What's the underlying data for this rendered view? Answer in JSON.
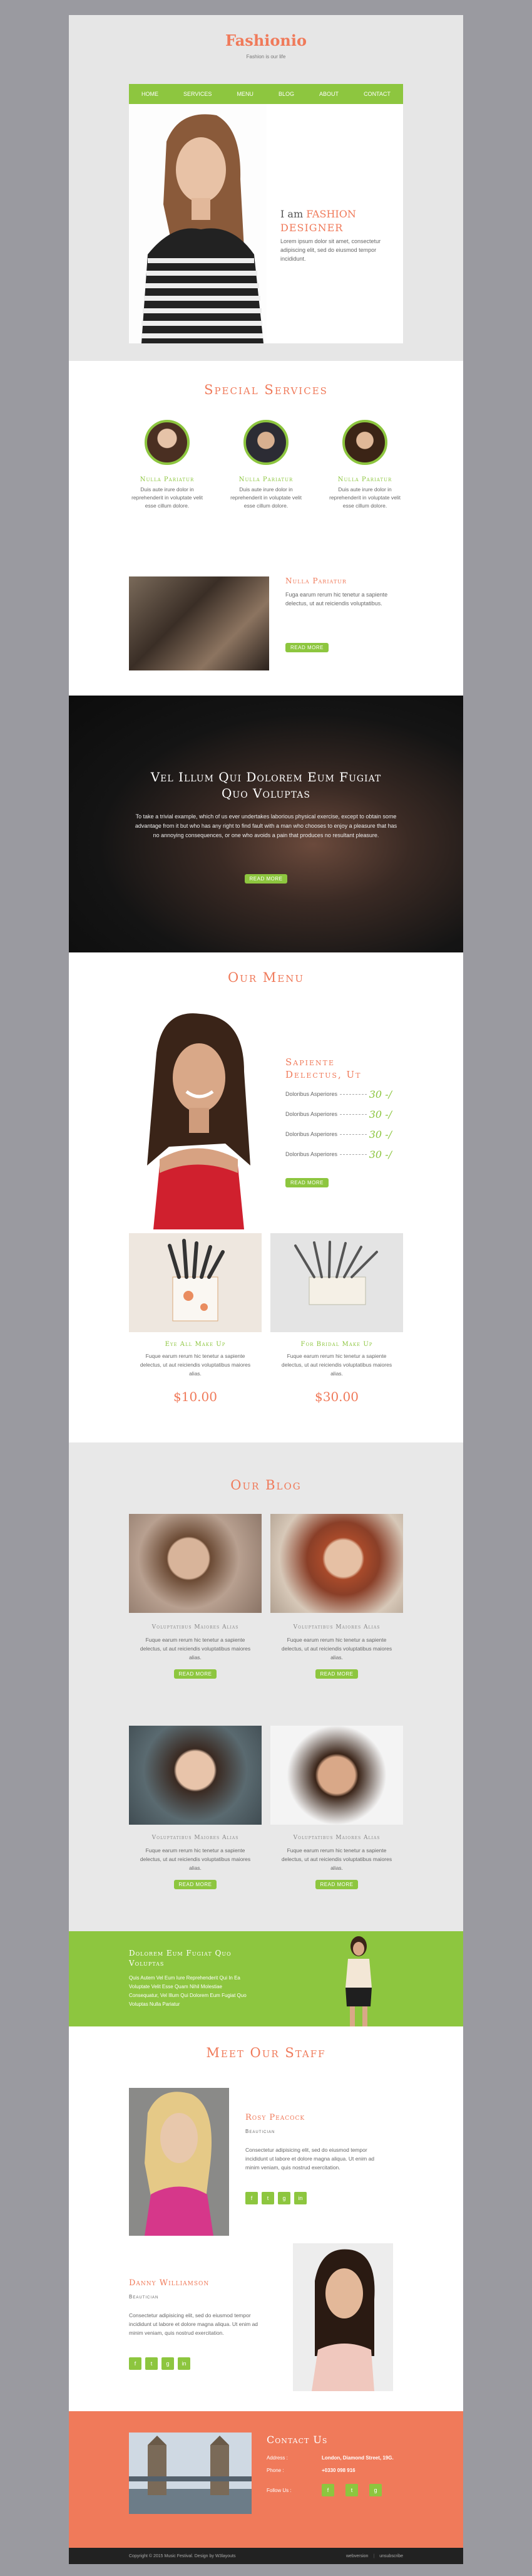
{
  "header": {
    "logo": "Fashionio",
    "tagline": "Fashion is our life"
  },
  "nav": {
    "items": [
      "HOME",
      "SERVICES",
      "MENU",
      "BLOG",
      "ABOUT",
      "CONTACT"
    ]
  },
  "hero": {
    "intro": "I am",
    "title_1": "FASHION",
    "title_2": "DESIGNER",
    "text": "Lorem ipsum dolor sit amet, consectetur adipiscing elit, sed do eiusmod tempor incididunt."
  },
  "services": {
    "title": "Special Services",
    "items": [
      {
        "name": "Nulla Pariatur",
        "text": "Duis aute irure dolor in reprehenderit in voluptate velit esse cillum dolore."
      },
      {
        "name": "Nulla Pariatur",
        "text": "Duis aute irure dolor in reprehenderit in voluptate velit esse cillum dolore."
      },
      {
        "name": "Nulla Pariatur",
        "text": "Duis aute irure dolor in reprehenderit in voluptate velit esse cillum dolore."
      }
    ],
    "feature": {
      "name": "Nulla Pariatur",
      "text": "Fuga earum rerum hic tenetur a sapiente delectus, ut aut reiciendis voluptatibus.",
      "button": "READ MORE"
    }
  },
  "banner": {
    "title_1": "Vel Illum Qui Dolorem Eum Fugiat",
    "title_2": "Quo Voluptas",
    "text": "To take a trivial example, which of us ever undertakes laborious physical exercise, except to obtain some advantage from it but who has any right to find fault with a man who chooses to enjoy a pleasure that has no annoying consequences, or one who avoids a pain that produces no resultant pleasure.",
    "button": "READ MORE"
  },
  "menu": {
    "title": "Our Menu",
    "heading_1": "Sapiente",
    "heading_2": "Delectus, Ut",
    "rows": [
      {
        "label": "Doloribus Asperiores",
        "price": "30 -/"
      },
      {
        "label": "Doloribus Asperiores",
        "price": "30 -/"
      },
      {
        "label": "Doloribus Asperiores",
        "price": "30 -/"
      },
      {
        "label": "Doloribus Asperiores",
        "price": "30 -/"
      }
    ],
    "button": "READ MORE",
    "products": [
      {
        "name": "Eye All Make Up",
        "text": "Fuque earum rerum hic tenetur a sapiente delectus, ut aut reiciendis voluptatibus maiores alias.",
        "price": "$10.00"
      },
      {
        "name": "For Bridal Make Up",
        "text": "Fuque earum rerum hic tenetur a sapiente delectus, ut aut reiciendis voluptatibus maiores alias.",
        "price": "$30.00"
      }
    ]
  },
  "blog": {
    "title": "Our Blog",
    "posts": [
      {
        "title": "Voluptatibus Maiores Alias",
        "text": "Fuque earum rerum hic tenetur a sapiente delectus, ut aut reiciendis voluptatibus maiores alias.",
        "button": "READ MORE"
      },
      {
        "title": "Voluptatibus Maiores Alias",
        "text": "Fuque earum rerum hic tenetur a sapiente delectus, ut aut reiciendis voluptatibus maiores alias.",
        "button": "READ MORE"
      },
      {
        "title": "Voluptatibus Maiores Alias",
        "text": "Fuque earum rerum hic tenetur a sapiente delectus, ut aut reiciendis voluptatibus maiores alias.",
        "button": "READ MORE"
      },
      {
        "title": "Voluptatibus Maiores Alias",
        "text": "Fuque earum rerum hic tenetur a sapiente delectus, ut aut reiciendis voluptatibus maiores alias.",
        "button": "READ MORE"
      }
    ]
  },
  "promo": {
    "title_1": "Dolorem Eum Fugiat Quo",
    "title_2": "Voluptas",
    "text": "Quis Autem Vel Eum Iure Reprehenderit Qui In Ea Voluptate Velit Esse Quam Nihil Molestiae Consequatur, Vel Illum Qui Dolorem Eum Fugiat Quo Voluptas Nulla Pariatur"
  },
  "staff": {
    "title": "Meet Our Staff",
    "members": [
      {
        "name": "Rosy Peacock",
        "role": "Beautician",
        "text": "Consectetur adipisicing elit, sed do eiusmod tempor incididunt ut labore et dolore magna aliqua. Ut enim ad minim veniam, quis nostrud exercitation."
      },
      {
        "name": "Danny Williamson",
        "role": "Beautician",
        "text": "Consectetur adipisicing elit, sed do eiusmod tempor incididunt ut labore et dolore magna aliqua. Ut enim ad minim veniam, quis nostrud exercitation."
      }
    ],
    "social": [
      "f",
      "t",
      "g",
      "in"
    ]
  },
  "contact": {
    "title": "Contact Us",
    "address_label": "Address :",
    "address": "London, Diamond Street, 19G.",
    "phone_label": "Phone :",
    "phone": "+0330 098 916",
    "follow_label": "Follow Us :",
    "social": [
      "f",
      "t",
      "g"
    ]
  },
  "footer": {
    "copyright": "Copyright © 2015 Music Festival. Design by W3layouts",
    "link_1": "webversion",
    "link_2": "unsubscribe"
  },
  "colors": {
    "accent": "#f07a5a",
    "green": "#8dc63f",
    "dark": "#222222",
    "grey": "#e9e9e9"
  }
}
